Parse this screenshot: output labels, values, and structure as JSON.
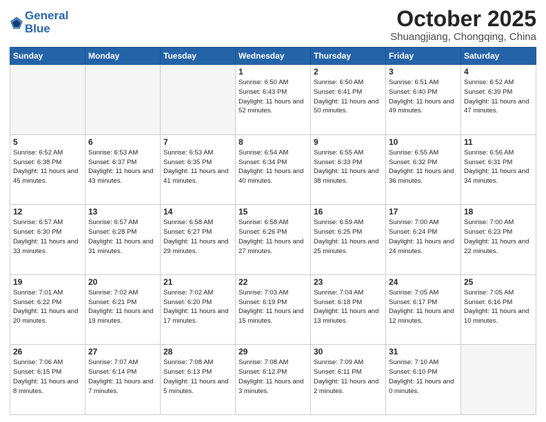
{
  "header": {
    "logo_text1": "General",
    "logo_text2": "Blue",
    "month_title": "October 2025",
    "location": "Shuangjiang, Chongqing, China"
  },
  "weekdays": [
    "Sunday",
    "Monday",
    "Tuesday",
    "Wednesday",
    "Thursday",
    "Friday",
    "Saturday"
  ],
  "weeks": [
    [
      {
        "day": "",
        "empty": true
      },
      {
        "day": "",
        "empty": true
      },
      {
        "day": "",
        "empty": true
      },
      {
        "day": "1",
        "sunrise": "6:50 AM",
        "sunset": "6:43 PM",
        "daylight": "11 hours and 52 minutes."
      },
      {
        "day": "2",
        "sunrise": "6:50 AM",
        "sunset": "6:41 PM",
        "daylight": "11 hours and 50 minutes."
      },
      {
        "day": "3",
        "sunrise": "6:51 AM",
        "sunset": "6:40 PM",
        "daylight": "11 hours and 49 minutes."
      },
      {
        "day": "4",
        "sunrise": "6:52 AM",
        "sunset": "6:39 PM",
        "daylight": "11 hours and 47 minutes."
      }
    ],
    [
      {
        "day": "5",
        "sunrise": "6:52 AM",
        "sunset": "6:38 PM",
        "daylight": "11 hours and 45 minutes."
      },
      {
        "day": "6",
        "sunrise": "6:53 AM",
        "sunset": "6:37 PM",
        "daylight": "11 hours and 43 minutes."
      },
      {
        "day": "7",
        "sunrise": "6:53 AM",
        "sunset": "6:35 PM",
        "daylight": "11 hours and 41 minutes."
      },
      {
        "day": "8",
        "sunrise": "6:54 AM",
        "sunset": "6:34 PM",
        "daylight": "11 hours and 40 minutes."
      },
      {
        "day": "9",
        "sunrise": "6:55 AM",
        "sunset": "6:33 PM",
        "daylight": "11 hours and 38 minutes."
      },
      {
        "day": "10",
        "sunrise": "6:55 AM",
        "sunset": "6:32 PM",
        "daylight": "11 hours and 36 minutes."
      },
      {
        "day": "11",
        "sunrise": "6:56 AM",
        "sunset": "6:31 PM",
        "daylight": "11 hours and 34 minutes."
      }
    ],
    [
      {
        "day": "12",
        "sunrise": "6:57 AM",
        "sunset": "6:30 PM",
        "daylight": "11 hours and 33 minutes."
      },
      {
        "day": "13",
        "sunrise": "6:57 AM",
        "sunset": "6:28 PM",
        "daylight": "11 hours and 31 minutes."
      },
      {
        "day": "14",
        "sunrise": "6:58 AM",
        "sunset": "6:27 PM",
        "daylight": "11 hours and 29 minutes."
      },
      {
        "day": "15",
        "sunrise": "6:58 AM",
        "sunset": "6:26 PM",
        "daylight": "11 hours and 27 minutes."
      },
      {
        "day": "16",
        "sunrise": "6:59 AM",
        "sunset": "6:25 PM",
        "daylight": "11 hours and 25 minutes."
      },
      {
        "day": "17",
        "sunrise": "7:00 AM",
        "sunset": "6:24 PM",
        "daylight": "11 hours and 24 minutes."
      },
      {
        "day": "18",
        "sunrise": "7:00 AM",
        "sunset": "6:23 PM",
        "daylight": "11 hours and 22 minutes."
      }
    ],
    [
      {
        "day": "19",
        "sunrise": "7:01 AM",
        "sunset": "6:22 PM",
        "daylight": "11 hours and 20 minutes."
      },
      {
        "day": "20",
        "sunrise": "7:02 AM",
        "sunset": "6:21 PM",
        "daylight": "11 hours and 19 minutes."
      },
      {
        "day": "21",
        "sunrise": "7:02 AM",
        "sunset": "6:20 PM",
        "daylight": "11 hours and 17 minutes."
      },
      {
        "day": "22",
        "sunrise": "7:03 AM",
        "sunset": "6:19 PM",
        "daylight": "11 hours and 15 minutes."
      },
      {
        "day": "23",
        "sunrise": "7:04 AM",
        "sunset": "6:18 PM",
        "daylight": "11 hours and 13 minutes."
      },
      {
        "day": "24",
        "sunrise": "7:05 AM",
        "sunset": "6:17 PM",
        "daylight": "11 hours and 12 minutes."
      },
      {
        "day": "25",
        "sunrise": "7:05 AM",
        "sunset": "6:16 PM",
        "daylight": "11 hours and 10 minutes."
      }
    ],
    [
      {
        "day": "26",
        "sunrise": "7:06 AM",
        "sunset": "6:15 PM",
        "daylight": "11 hours and 8 minutes."
      },
      {
        "day": "27",
        "sunrise": "7:07 AM",
        "sunset": "6:14 PM",
        "daylight": "11 hours and 7 minutes."
      },
      {
        "day": "28",
        "sunrise": "7:08 AM",
        "sunset": "6:13 PM",
        "daylight": "11 hours and 5 minutes."
      },
      {
        "day": "29",
        "sunrise": "7:08 AM",
        "sunset": "6:12 PM",
        "daylight": "11 hours and 3 minutes."
      },
      {
        "day": "30",
        "sunrise": "7:09 AM",
        "sunset": "6:11 PM",
        "daylight": "11 hours and 2 minutes."
      },
      {
        "day": "31",
        "sunrise": "7:10 AM",
        "sunset": "6:10 PM",
        "daylight": "11 hours and 0 minutes."
      },
      {
        "day": "",
        "empty": true
      }
    ]
  ]
}
